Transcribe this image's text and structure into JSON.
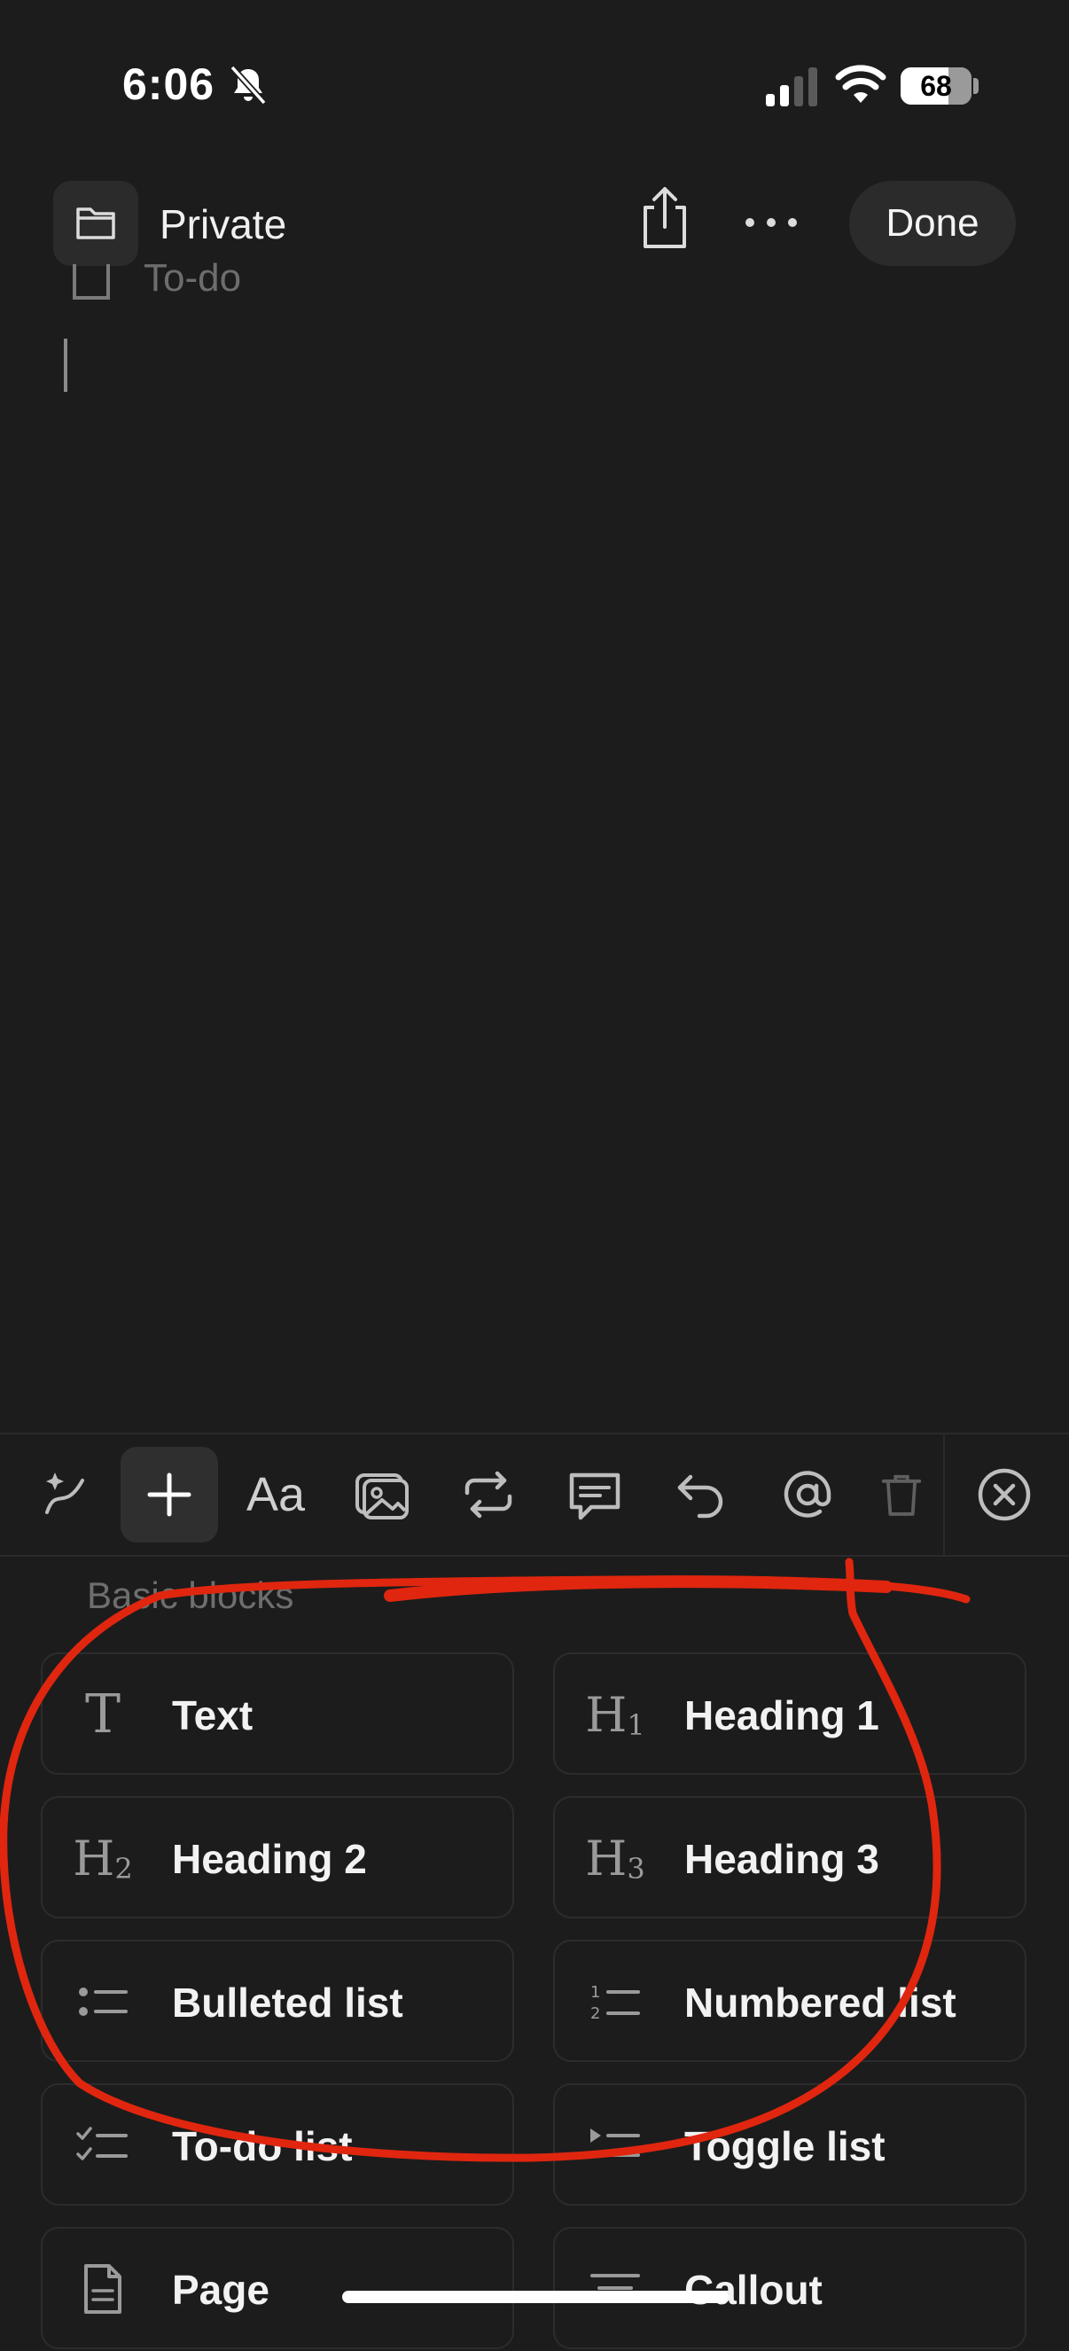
{
  "status_bar": {
    "time": "6:06",
    "battery": "68",
    "battery_level": 0.68
  },
  "nav": {
    "title": "Private",
    "done_label": "Done"
  },
  "editor": {
    "todo_placeholder": "To-do"
  },
  "toolbar": {
    "aa_label": "Aa"
  },
  "blocks": {
    "section_label": "Basic blocks",
    "items": [
      {
        "label": "Text",
        "icon": "text-icon"
      },
      {
        "label": "Heading 1",
        "icon": "heading-1-icon",
        "glyph": "H",
        "sub": "1"
      },
      {
        "label": "Heading 2",
        "icon": "heading-2-icon",
        "glyph": "H",
        "sub": "2"
      },
      {
        "label": "Heading 3",
        "icon": "heading-3-icon",
        "glyph": "H",
        "sub": "3"
      },
      {
        "label": "Bulleted list",
        "icon": "bulleted-list-icon"
      },
      {
        "label": "Numbered list",
        "icon": "numbered-list-icon"
      },
      {
        "label": "To-do list",
        "icon": "todo-list-icon"
      },
      {
        "label": "Toggle list",
        "icon": "toggle-list-icon"
      },
      {
        "label": "Page",
        "icon": "page-icon"
      },
      {
        "label": "Callout",
        "icon": "callout-icon"
      }
    ]
  },
  "annotation_color": "#e0260f"
}
